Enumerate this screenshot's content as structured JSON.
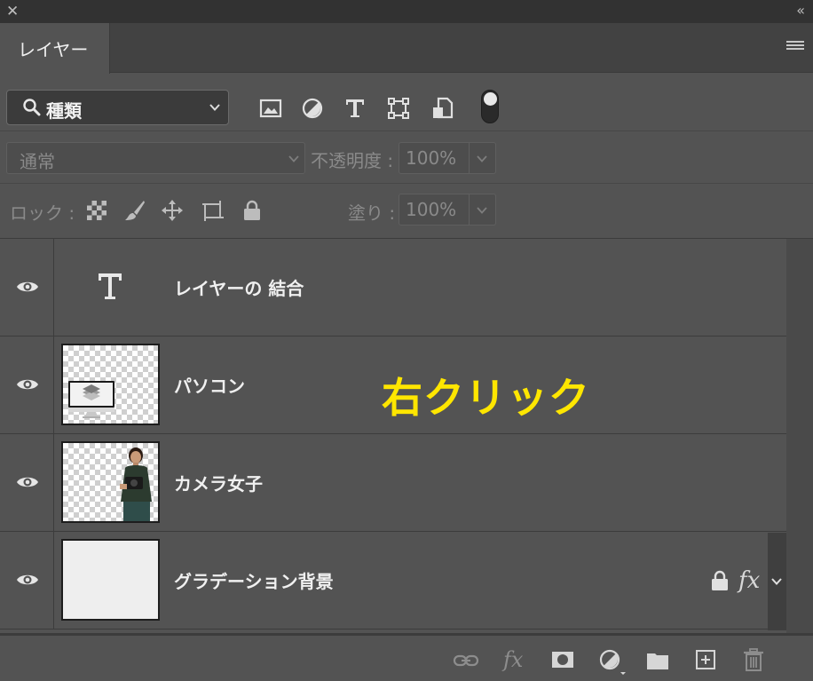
{
  "titlebar": {
    "close": "✕",
    "collapse": "‹‹"
  },
  "panel": {
    "tab_label": "レイヤー"
  },
  "filter": {
    "kind_label": "種類",
    "icons": [
      "image-filter-icon",
      "adjustment-filter-icon",
      "type-filter-icon",
      "shape-filter-icon",
      "smart-object-filter-icon"
    ],
    "toggle": "on"
  },
  "blend": {
    "mode": "通常",
    "opacity_label": "不透明度 :",
    "opacity_value": "100%"
  },
  "lock": {
    "label": "ロック :",
    "icons": [
      "lock-transparent-icon",
      "lock-image-icon",
      "lock-position-icon",
      "lock-artboard-icon",
      "lock-all-icon"
    ],
    "fill_label": "塗り :",
    "fill_value": "100%"
  },
  "layers": [
    {
      "name": "レイヤーの 結合",
      "type": "text"
    },
    {
      "name": "パソコン",
      "type": "image"
    },
    {
      "name": "カメラ女子",
      "type": "image"
    },
    {
      "name": "グラデーション背景",
      "type": "background",
      "locked": true,
      "fx": "fx"
    }
  ],
  "annotation": "右クリック",
  "bottom_icons": [
    "link-layers-icon",
    "fx-icon",
    "add-mask-icon",
    "adjustment-layer-icon",
    "new-group-icon",
    "new-layer-icon",
    "delete-layer-icon"
  ],
  "bottom_fx": "fx",
  "colors": {
    "panel_bg": "#535353",
    "annotation": "#ffe600",
    "dark_bar": "#323232"
  }
}
